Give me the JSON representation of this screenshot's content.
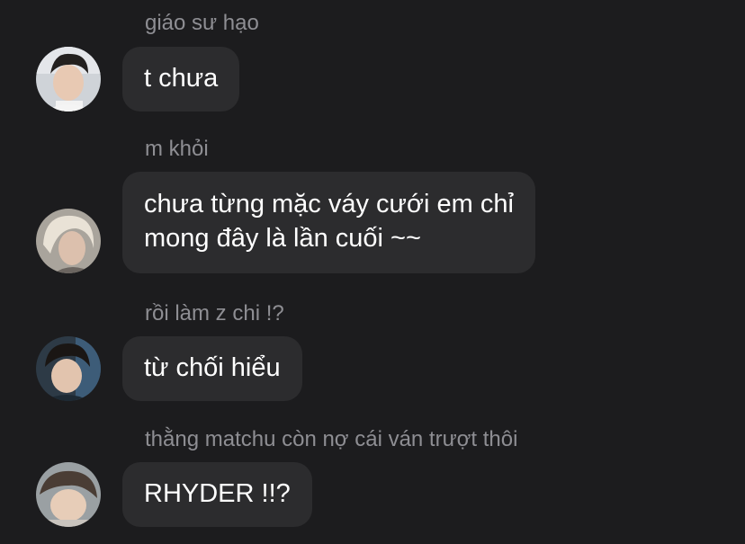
{
  "messages": [
    {
      "sender": "giáo sư hạo",
      "lines": [
        "t chưa"
      ],
      "avatar": "avatar-photo-1"
    },
    {
      "sender": "m khỏi",
      "lines": [
        "chưa từng mặc váy cưới em chỉ",
        "mong đây là lần cuối ~~"
      ],
      "avatar": "avatar-photo-2"
    },
    {
      "sender": "rồi làm z chi !?",
      "lines": [
        "từ chối hiểu"
      ],
      "avatar": "avatar-photo-3"
    },
    {
      "sender": "thằng matchu còn nợ cái ván trượt thôi",
      "lines": [
        "RHYDER !!?"
      ],
      "avatar": "avatar-photo-4"
    }
  ],
  "colors": {
    "background": "#1c1c1e",
    "bubble": "#2c2c2e",
    "sender_text": "#8e8e93",
    "message_text": "#ffffff"
  }
}
